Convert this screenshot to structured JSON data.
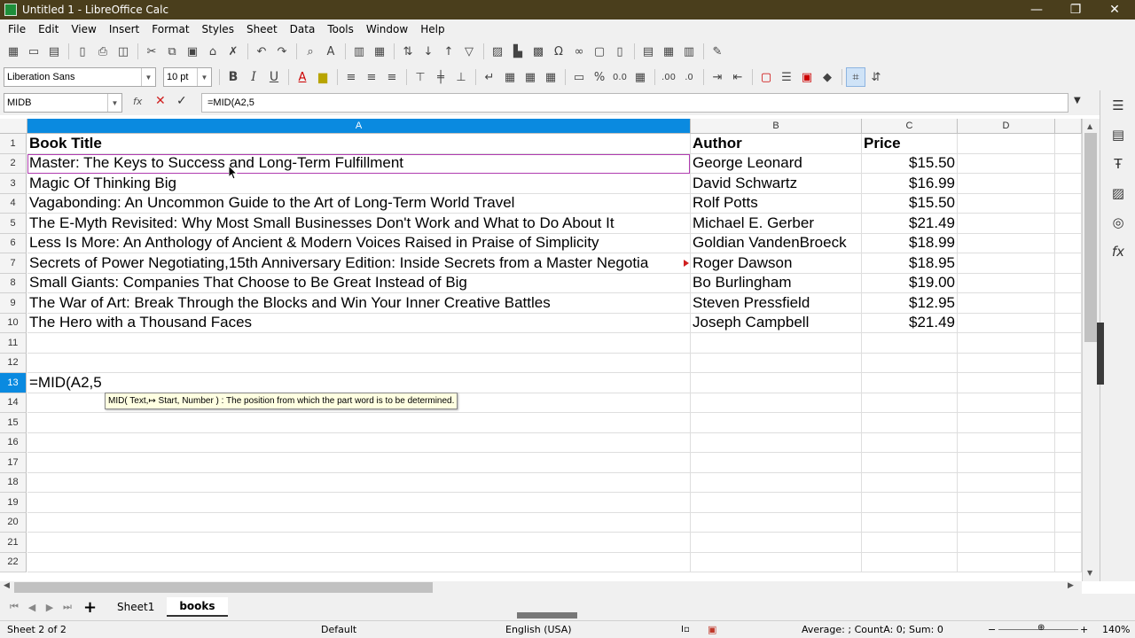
{
  "window": {
    "title": "Untitled 1 - LibreOffice Calc",
    "minimize": "—",
    "restore": "❐",
    "close": "✕"
  },
  "menu": [
    "File",
    "Edit",
    "View",
    "Insert",
    "Format",
    "Styles",
    "Sheet",
    "Data",
    "Tools",
    "Window",
    "Help"
  ],
  "toolbar2": {
    "font_name": "Liberation Sans",
    "font_size": "10 pt",
    "bold": "B",
    "italic": "I",
    "underline": "U"
  },
  "formula_bar": {
    "name_box": "MIDB",
    "fx": "fx",
    "cancel": "✕",
    "accept": "✓",
    "formula": "=MID(A2,5"
  },
  "columns": [
    "A",
    "B",
    "C",
    "D"
  ],
  "rows": [
    "1",
    "2",
    "3",
    "4",
    "5",
    "6",
    "7",
    "8",
    "9",
    "10",
    "11",
    "12",
    "13",
    "14",
    "15",
    "16",
    "17",
    "18",
    "19",
    "20",
    "21",
    "22"
  ],
  "cells": {
    "headers": {
      "title": "Book Title",
      "author": "Author",
      "price": "Price"
    },
    "data": [
      {
        "title": "Master: The Keys to Success and Long-Term Fulfillment",
        "author": "George Leonard",
        "price": "$15.50"
      },
      {
        "title": "Magic Of Thinking Big",
        "author": "David Schwartz",
        "price": "$16.99"
      },
      {
        "title": "Vagabonding: An Uncommon Guide to the Art of Long-Term World Travel",
        "author": "Rolf Potts",
        "price": "$15.50"
      },
      {
        "title": "The E-Myth Revisited: Why Most Small Businesses Don't Work and What to Do About It",
        "author": "Michael E. Gerber",
        "price": "$21.49"
      },
      {
        "title": "Less Is More: An Anthology of Ancient & Modern Voices Raised in Praise of Simplicity",
        "author": "Goldian VandenBroeck",
        "price": "$18.99"
      },
      {
        "title": "Secrets of Power Negotiating,15th Anniversary Edition: Inside Secrets from a Master Negotia",
        "author": "Roger Dawson",
        "price": "$18.95"
      },
      {
        "title": "Small Giants: Companies That Choose to Be Great Instead of Big",
        "author": "Bo Burlingham",
        "price": "$19.00"
      },
      {
        "title": "The War of Art: Break Through the Blocks and Win Your Inner Creative Battles",
        "author": "Steven Pressfield",
        "price": "$12.95"
      },
      {
        "title": "The Hero with a Thousand Faces",
        "author": "Joseph Campbell",
        "price": "$21.49"
      }
    ],
    "a13": "=MID(A2,5"
  },
  "tooltip": "MID( Text,↦ Start, Number ) : The position from which the part word is to be determined.",
  "sheets": [
    {
      "name": "Sheet1",
      "active": false
    },
    {
      "name": "books",
      "active": true
    }
  ],
  "add_sheet": "+",
  "status": {
    "sheet": "Sheet 2 of 2",
    "style": "Default",
    "language": "English (USA)",
    "summary": "Average: ; CountA: 0; Sum: 0",
    "zoom": "140%"
  },
  "colors": {
    "title_bar": "#4a3e1c",
    "selection": "#0a8ae0",
    "cell_cursor": "#b03cb0"
  }
}
